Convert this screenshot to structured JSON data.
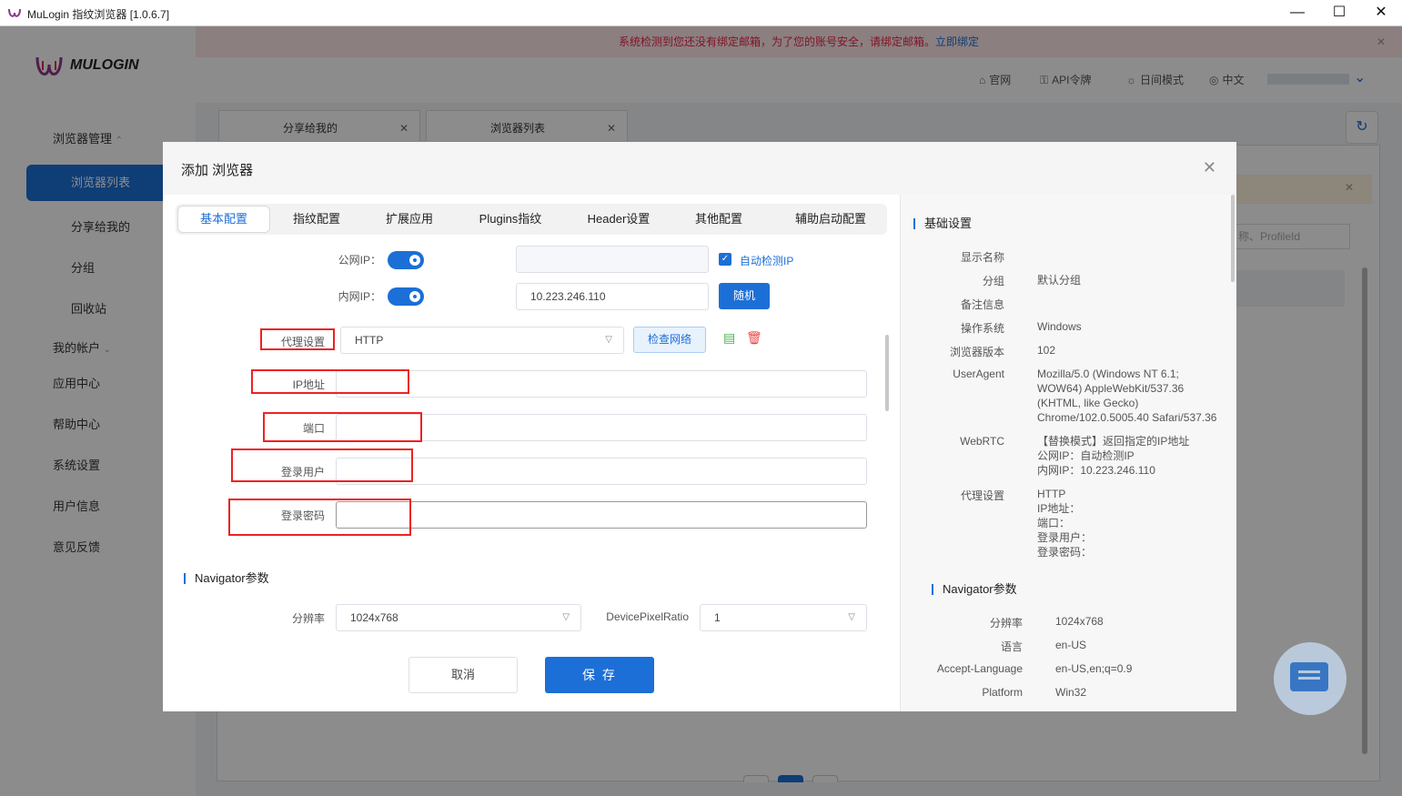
{
  "window": {
    "title": "MuLogin 指纹浏览器  [1.0.6.7]",
    "minimize": "—",
    "maximize": "☐",
    "close": "✕"
  },
  "notice": {
    "text": "系统检测到您还没有绑定邮箱，为了您的账号安全，请绑定邮箱。",
    "link": "立即绑定"
  },
  "brand": {
    "name": "MULOGIN"
  },
  "topnav": {
    "home": "官网",
    "api": "API令牌",
    "theme": "日间模式",
    "lang": "中文"
  },
  "sidebar": {
    "browser_mgmt": "浏览器管理",
    "browser_list": "浏览器列表",
    "shared": "分享给我的",
    "group": "分组",
    "recycle": "回收站",
    "account": "我的帐户",
    "apps": "应用中心",
    "help": "帮助中心",
    "settings": "系统设置",
    "userinfo": "用户信息",
    "feedback": "意见反馈"
  },
  "bg_tabs": [
    "分享给我的",
    "浏览器列表"
  ],
  "bg_search_placeholder": "称、ProfileId",
  "modal": {
    "title": "添加 浏览器",
    "tabs": [
      "基本配置",
      "指纹配置",
      "扩展应用",
      "Plugins指纹",
      "Header设置",
      "其他配置",
      "辅助启动配置"
    ],
    "public_ip_label": "公网IP：",
    "internal_ip_label": "内网IP：",
    "auto_detect": "自动检测IP",
    "internal_ip_value": "10.223.246.110",
    "random_btn": "随机",
    "proxy_label": "代理设置",
    "proxy_value": "HTTP",
    "check_network": "检查网络",
    "ip_addr_label": "IP地址",
    "port_label": "端口",
    "login_user_label": "登录用户",
    "login_pass_label": "登录密码",
    "navigator_title": "Navigator参数",
    "resolution_label": "分辨率",
    "resolution_value": "1024x768",
    "dpr_label": "DevicePixelRatio",
    "dpr_value": "1",
    "cancel": "取消",
    "save": "保 存"
  },
  "summary": {
    "basic_title": "基础设置",
    "display_name_k": "显示名称",
    "group_k": "分组",
    "group_v": "默认分组",
    "remark_k": "备注信息",
    "os_k": "操作系统",
    "os_v": "Windows",
    "ver_k": "浏览器版本",
    "ver_v": "102",
    "ua_k": "UserAgent",
    "ua_v1": "Mozilla/5.0 (Windows NT 6.1;",
    "ua_v2": "WOW64) AppleWebKit/537.36",
    "ua_v3": "(KHTML, like Gecko)",
    "ua_v4": "Chrome/102.0.5005.40 Safari/537.36",
    "webrtc_k": "WebRTC",
    "webrtc_v1": "【替换模式】返回指定的IP地址",
    "webrtc_v2": "公网IP：自动检测IP",
    "webrtc_v3": "内网IP：10.223.246.110",
    "proxy_k": "代理设置",
    "proxy_v1": "HTTP",
    "proxy_v2": "IP地址：",
    "proxy_v3": "端口：",
    "proxy_v4": "登录用户：",
    "proxy_v5": "登录密码：",
    "nav_title": "Navigator参数",
    "res_k": "分辨率",
    "res_v": "1024x768",
    "lang_k": "语言",
    "lang_v": "en-US",
    "accept_k": "Accept-Language",
    "accept_v": "en-US,en;q=0.9",
    "platform_k": "Platform",
    "platform_v": "Win32"
  },
  "colors": {
    "accent": "#1c6fd6",
    "highlight_box": "#e22222"
  }
}
